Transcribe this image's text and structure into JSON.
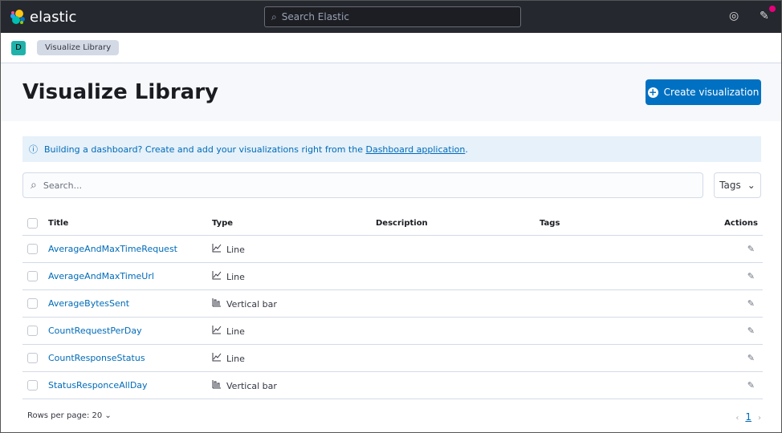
{
  "topbar": {
    "brand": "elastic",
    "search_placeholder": "Search Elastic"
  },
  "breadcrumb": {
    "avatar": "D",
    "item": "Visualize Library"
  },
  "header": {
    "title": "Visualize Library",
    "create_label": "Create visualization"
  },
  "callout": {
    "text": "Building a dashboard? Create and add your visualizations right from the ",
    "link": "Dashboard application",
    "end": "."
  },
  "search": {
    "placeholder": "Search...",
    "tags_label": "Tags"
  },
  "table": {
    "headers": [
      "Title",
      "Type",
      "Description",
      "Tags",
      "Actions"
    ],
    "rows": [
      {
        "title": "AverageAndMaxTimeRequest",
        "type": "Line",
        "icon": "line-chart-icon"
      },
      {
        "title": "AverageAndMaxTimeUrl",
        "type": "Line",
        "icon": "line-chart-icon"
      },
      {
        "title": "AverageBytesSent",
        "type": "Vertical bar",
        "icon": "bar-chart-icon"
      },
      {
        "title": "CountRequestPerDay",
        "type": "Line",
        "icon": "line-chart-icon"
      },
      {
        "title": "CountResponseStatus",
        "type": "Line",
        "icon": "line-chart-icon"
      },
      {
        "title": "StatusResponceAllDay",
        "type": "Vertical bar",
        "icon": "bar-chart-icon"
      }
    ]
  },
  "footer": {
    "rows_per_page": "Rows per page: 20",
    "page": "1"
  }
}
